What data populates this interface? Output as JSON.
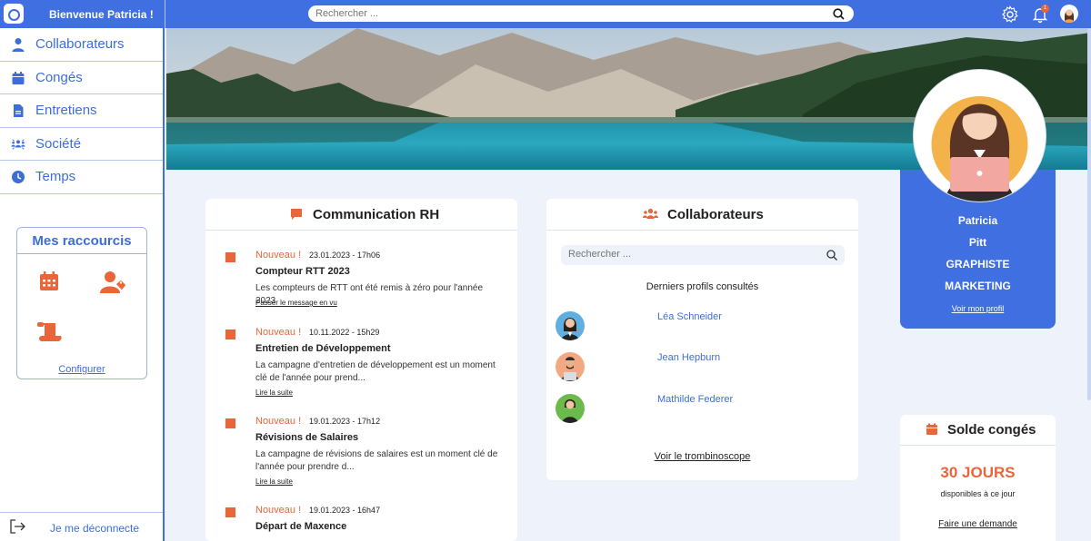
{
  "header": {
    "welcome": "Bienvenue Patricia !",
    "search_placeholder": "Rechercher ...",
    "notification_count": "1"
  },
  "sidebar": {
    "items": [
      {
        "label": "Collaborateurs",
        "icon": "user-icon"
      },
      {
        "label": "Congés",
        "icon": "calendar-icon"
      },
      {
        "label": "Entretiens",
        "icon": "document-icon"
      },
      {
        "label": "Société",
        "icon": "people-network-icon"
      },
      {
        "label": "Temps",
        "icon": "clock-icon"
      }
    ],
    "shortcuts": {
      "title": "Mes raccourcis",
      "configure": "Configurer"
    },
    "logout": "Je me déconnecte"
  },
  "communication": {
    "title": "Communication RH",
    "items": [
      {
        "tag": "Nouveau !",
        "date": "23.01.2023 - 17h06",
        "title": "Compteur RTT 2023",
        "text": "Les compteurs de RTT ont été remis à zéro pour l'année 2023",
        "link": "Passer le message en vu"
      },
      {
        "tag": "Nouveau !",
        "date": "10.11.2022 - 15h29",
        "title": "Entretien de Développement",
        "text": "La campagne d'entretien de développement est un moment clé de l'année pour prend...",
        "link": "Lire la suite"
      },
      {
        "tag": "Nouveau !",
        "date": "19.01.2023 - 17h12",
        "title": "Révisions de Salaires",
        "text": "La campagne de révisions de salaires est un moment clé de l'année pour prendre d...",
        "link": "Lire la suite"
      },
      {
        "tag": "Nouveau !",
        "date": "19.01.2023 - 16h47",
        "title": "Départ de Maxence",
        "text": "",
        "link": ""
      }
    ]
  },
  "collaborateurs": {
    "title": "Collaborateurs",
    "search_placeholder": "Rechercher ...",
    "recent_title": "Derniers profils consultés",
    "people": [
      {
        "name": "Léa Schneider"
      },
      {
        "name": "Jean Hepburn"
      },
      {
        "name": "Mathilde Federer"
      }
    ],
    "see_all": "Voir le trombinoscope"
  },
  "profile": {
    "first_name": "Patricia",
    "last_name": "Pitt",
    "role": "GRAPHISTE",
    "department": "MARKETING",
    "link": "Voir mon profil"
  },
  "leave": {
    "title": "Solde congés",
    "amount": "30 JOURS",
    "subtitle": "disponibles à ce jour",
    "request": "Faire une demande"
  },
  "colors": {
    "primary": "#3f6fe0",
    "accent": "#e8663a",
    "background": "#eef2fb"
  }
}
